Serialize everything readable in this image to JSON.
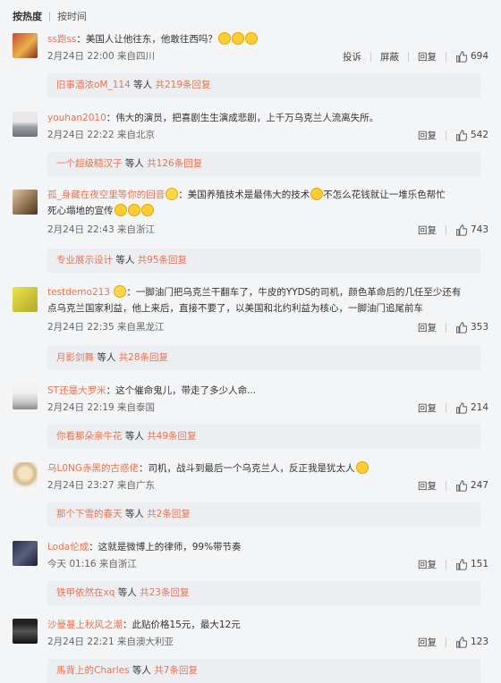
{
  "sort": {
    "hot": "按热度",
    "time": "按时间"
  },
  "actions": {
    "report": "投诉",
    "block": "屏蔽",
    "reply": "回复"
  },
  "comments": [
    {
      "user": "ss跑ss",
      "text": "：美国人让他往东，他敢往西吗？",
      "time": "2月24日 22:00 来自四川",
      "likes": "694",
      "sub_user": "旧事酒浓oM_114",
      "sub_mid": " 等人 ",
      "sub_count": "共219条回复"
    },
    {
      "user": "youhan2010",
      "text": "：伟大的演员，把喜剧生生演成悲剧，上千万乌克兰人流离失所。",
      "time": "2月24日 22:22 来自北京",
      "likes": "542",
      "sub_user": "一个超级糙汉子",
      "sub_mid": " 等人 ",
      "sub_count": "共126条回复"
    },
    {
      "user": "孤_身藏在夜空里等你的回音",
      "text_a": "：美国养殖技术是最伟大的技术",
      "text_b": "不怎么花钱就让一堆乐色帮忙",
      "text_c": "死心塌地的宣传",
      "time": "2月24日 22:43 来自浙江",
      "likes": "743",
      "sub_user": "专业展示设计",
      "sub_mid": " 等人 ",
      "sub_count": "共95条回复"
    },
    {
      "user": "testdemo213",
      "text_a": "：一脚油门把乌克兰干翻车了，牛皮的YYDS的司机，颜色革命后的几任至少还有",
      "text_b": "点乌克兰国家利益，他上来后，直接不要了，以美国和北约利益为核心，一脚油门追尾前车",
      "time": "2月24日 22:35 来自黑龙江",
      "likes": "353",
      "sub_user": "月影剑舞",
      "sub_mid": " 等人 ",
      "sub_count": "共28条回复"
    },
    {
      "user": "ST还是大罗米",
      "text": "：这个催命鬼儿，带走了多少人命...",
      "time": "2月24日 22:19 来自泰国",
      "likes": "214",
      "sub_user": "你看那朵亲牛花",
      "sub_mid": " 等人 ",
      "sub_count": "共49条回复"
    },
    {
      "user": "乌L0NG赤黑的古惑佬",
      "text": "：司机，战斗到最后一个乌克兰人，反正我是犹太人",
      "time": "2月24日 23:27 来自广东",
      "likes": "247",
      "sub_user": "那个下雪的春天",
      "sub_mid": " 等人 ",
      "sub_count": "共2条回复"
    },
    {
      "user": "Loda伦成",
      "text": "：这就是微博上的律师，99%带节奏",
      "time": "今天 01:16 来自浙江",
      "likes": "151",
      "sub_user": "铁甲依然在xq",
      "sub_mid": " 等人 ",
      "sub_count": "共23条回复"
    },
    {
      "user": "沙曼蔓上秋风之潮",
      "text": "：此贴价格15元，最大12元",
      "time": "2月24日 22:21 来自澳大利亚",
      "likes": "123",
      "sub_user": "馬背上的Charles",
      "sub_mid": " 等人 ",
      "sub_count": "共7条回复"
    }
  ],
  "colors": {
    "username": "#eb7350",
    "bg": "#f4f5f7",
    "sub_bg": "#eceef2"
  }
}
